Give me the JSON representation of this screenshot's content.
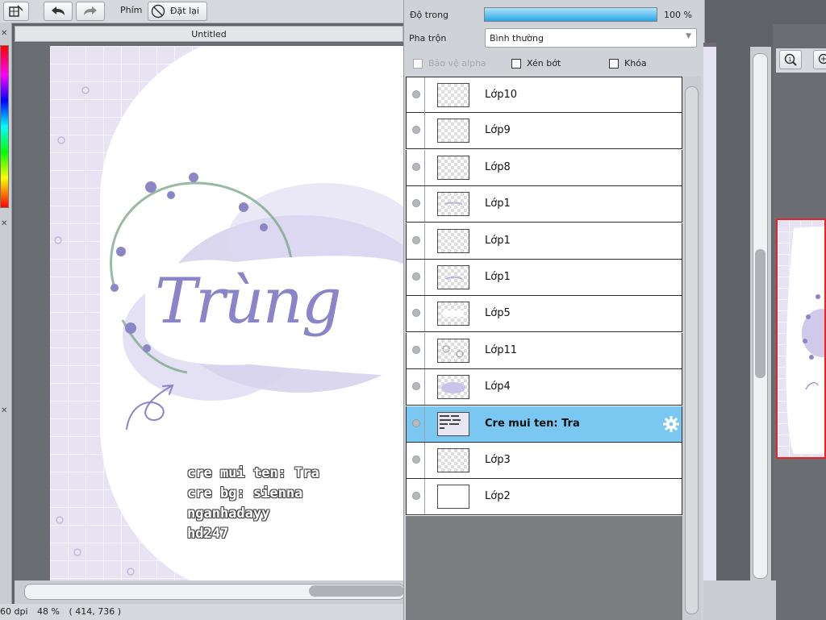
{
  "toolbar": {
    "keys_label": "Phím",
    "reset_label": "Đặt lại"
  },
  "document": {
    "tab_title": "Untitled",
    "art_lines": [
      "Trùng",
      "cre mui ten: Tra",
      "cre bg: sienna",
      "nganhadayy",
      "hd247"
    ]
  },
  "status": {
    "dpi": "60 dpi",
    "zoom": "48 %",
    "coords": "( 414, 736 )"
  },
  "layer_panel": {
    "opacity_label": "Độ trong",
    "opacity_value": "100 %",
    "opacity_fraction": 1.0,
    "blend_label": "Pha trộn",
    "blend_value": "Bình thường",
    "protect_alpha_label": "Bảo vệ alpha",
    "clip_label": "Xén bớt",
    "lock_label": "Khóa",
    "layers": [
      {
        "name": "Lớp10",
        "selected": false
      },
      {
        "name": "Lớp9",
        "selected": false
      },
      {
        "name": "Lớp8",
        "selected": false
      },
      {
        "name": "Lớp1",
        "selected": false
      },
      {
        "name": "Lớp1",
        "selected": false
      },
      {
        "name": "Lớp1",
        "selected": false
      },
      {
        "name": "Lớp5",
        "selected": false
      },
      {
        "name": "Lớp11",
        "selected": false
      },
      {
        "name": "Lớp4",
        "selected": false
      },
      {
        "name": "Cre mui ten: Tra",
        "selected": true
      },
      {
        "name": "Lớp3",
        "selected": false
      },
      {
        "name": "Lớp2",
        "selected": false
      }
    ]
  },
  "colors": {
    "selected_layer": "#7ac8f1",
    "artboard_bg": "#e7e3f3",
    "lettering": "#8a84c9"
  }
}
